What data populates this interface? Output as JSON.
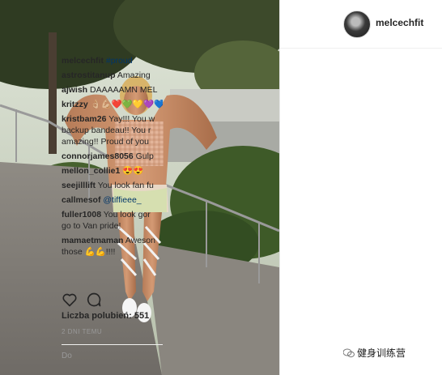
{
  "post": {
    "username": "melcechfit",
    "caption": {
      "user": "melcechfit",
      "text": "#proud"
    },
    "likes_label": "Liczba polubień:",
    "likes_count": "551",
    "time_ago": "2 DNI TEMU",
    "add_comment_placeholder": "Do"
  },
  "comments": [
    {
      "user": "astrostitanup",
      "text": "Amazing",
      "line2": ""
    },
    {
      "user": "ajwish",
      "text": "DAAAAAMN MEL",
      "line2": ""
    },
    {
      "user": "kritzzy",
      "text": "👌🏼💪🏼❤️💚💛💜💙",
      "line2": ""
    },
    {
      "user": "kristbam26",
      "text": "Yay!!! You w",
      "line2": "backup bandeau!! You r",
      "line3": "amazing!! Proud of you"
    },
    {
      "user": "connorjames8056",
      "text": "Gulp",
      "line2": ""
    },
    {
      "user": "mellon_collie1",
      "text": "😍😍",
      "line2": ""
    },
    {
      "user": "seejilllift",
      "text": "You look fan fu",
      "line2": ""
    },
    {
      "user": "callmesof",
      "text": "@tiffieee_",
      "line2": ""
    },
    {
      "user": "fuller1008",
      "text": "You look gor",
      "line2": "go to Van pride!"
    },
    {
      "user": "mamaetmaman",
      "text": "Aweson",
      "line2": "those 💪💪!!!!"
    }
  ],
  "watermark": {
    "text": "健身训练营"
  },
  "colors": {
    "text": "#262626",
    "muted": "#999999",
    "mention": "#003569",
    "border": "#efefef"
  },
  "icons": [
    "heart-icon",
    "comment-icon",
    "wechat-logo-icon"
  ]
}
